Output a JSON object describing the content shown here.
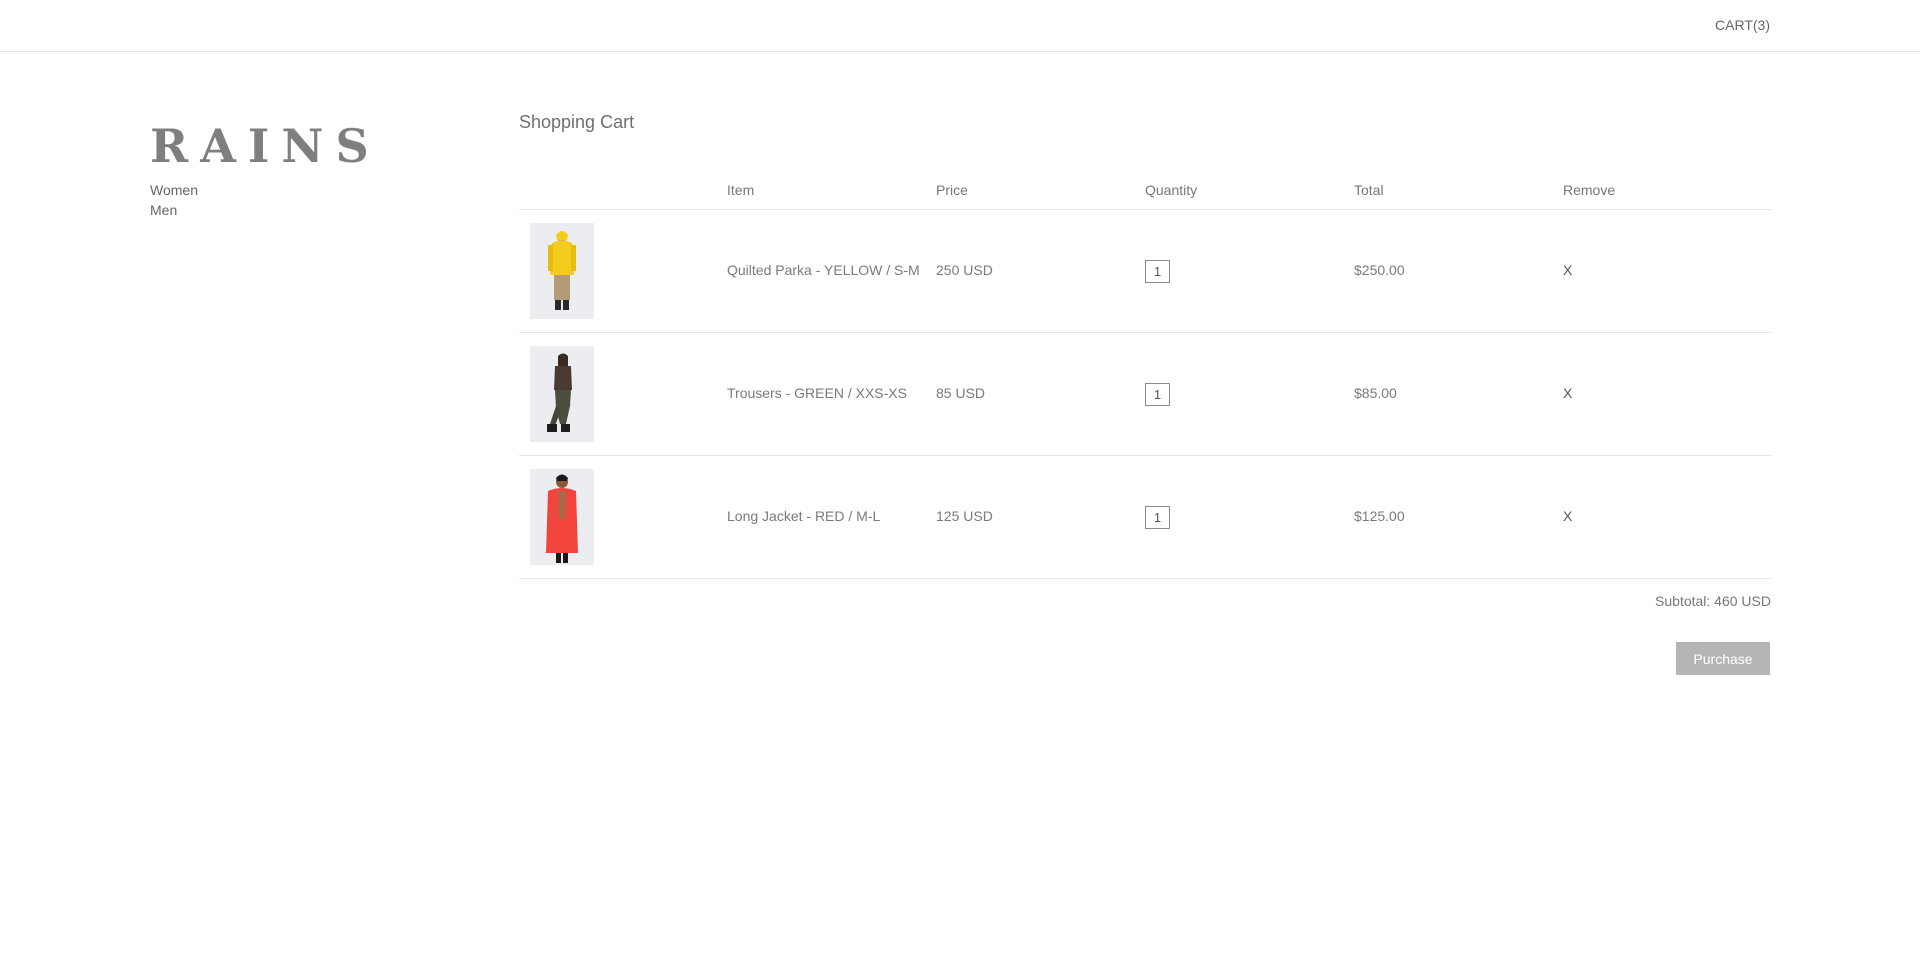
{
  "header": {
    "cart_label": "CART(3)"
  },
  "sidebar": {
    "logo": "RAINS",
    "nav": [
      {
        "label": "Women"
      },
      {
        "label": "Men"
      }
    ]
  },
  "main": {
    "title": "Shopping Cart",
    "columns": {
      "item": "Item",
      "price": "Price",
      "quantity": "Quantity",
      "total": "Total",
      "remove": "Remove"
    },
    "rows": [
      {
        "name": "Quilted Parka - YELLOW / S-M",
        "price": "250 USD",
        "quantity": "1",
        "total": "$250.00",
        "remove": "X",
        "thumb_icon": "model-yellow-parka",
        "thumb_color": "#f4cc1c"
      },
      {
        "name": "Trousers - GREEN / XXS-XS",
        "price": "85 USD",
        "quantity": "1",
        "total": "$85.00",
        "remove": "X",
        "thumb_icon": "model-green-trousers",
        "thumb_color": "#4a4e3f"
      },
      {
        "name": "Long Jacket - RED / M-L",
        "price": "125 USD",
        "quantity": "1",
        "total": "$125.00",
        "remove": "X",
        "thumb_icon": "model-red-jacket",
        "thumb_color": "#f0443c"
      }
    ],
    "subtotal": "Subtotal: 460 USD",
    "purchase_label": "Purchase"
  },
  "colors": {
    "border": "#e6e6e6",
    "purchase_bg": "#b5b5b5",
    "text": "#777777"
  }
}
